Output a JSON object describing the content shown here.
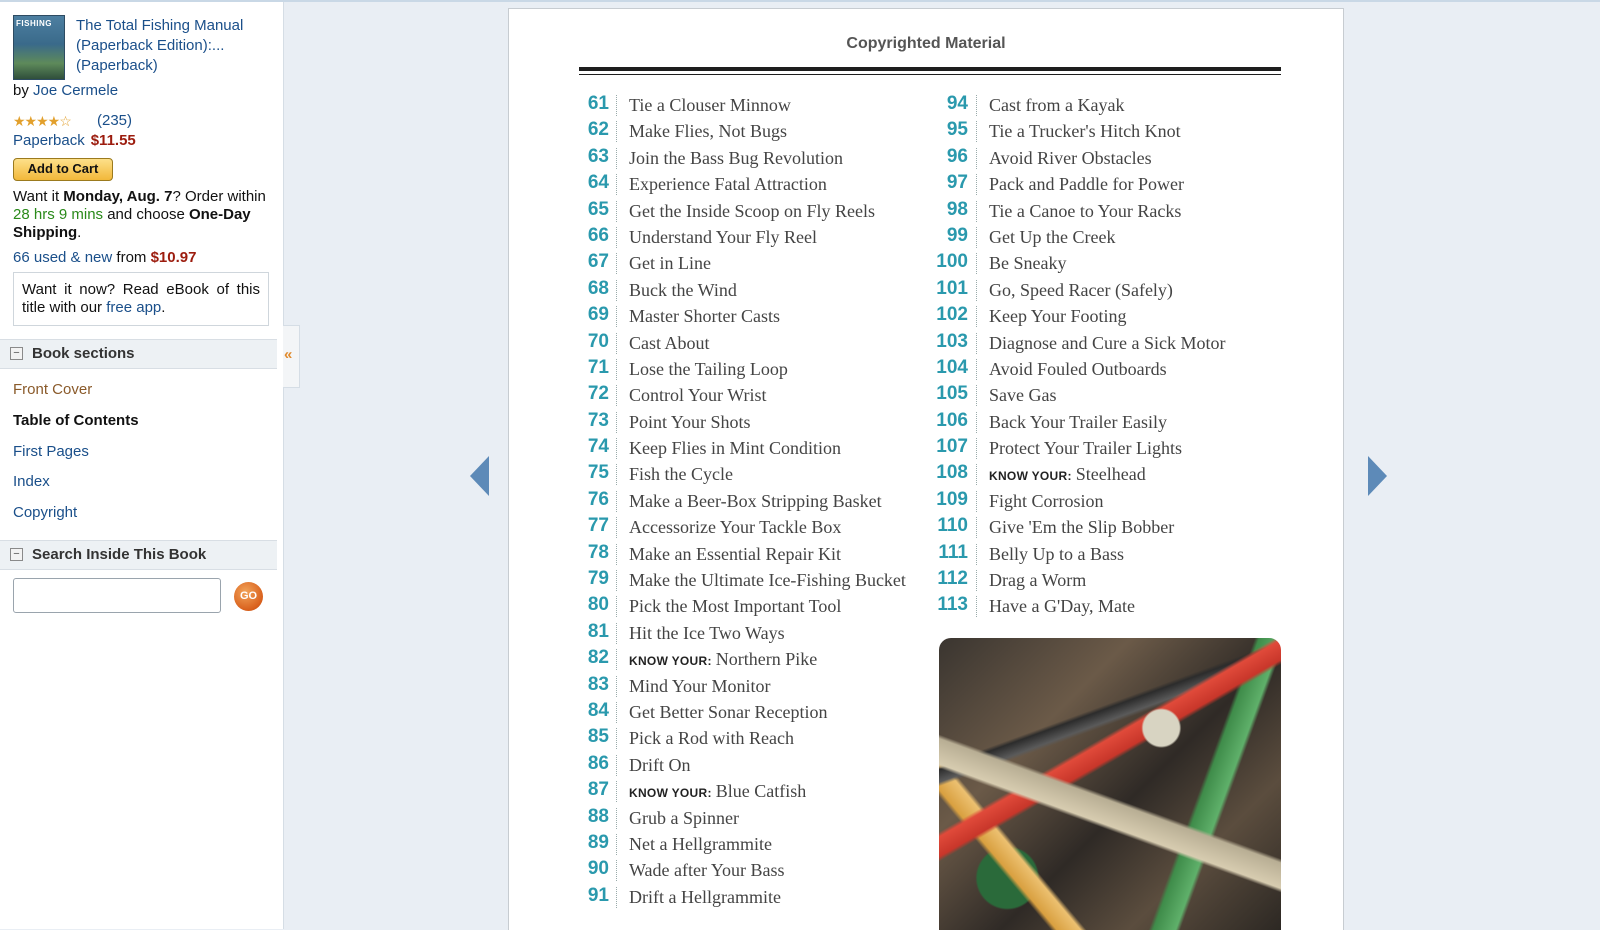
{
  "book": {
    "cover_text": "FISHING",
    "title": "The Total Fishing Manual (Paperback Edition):... (Paperback)",
    "by_label": "by",
    "author": "Joe Cermele",
    "stars": "★★★★☆",
    "review_count": "(235)",
    "format": "Paperback",
    "price": "$11.55",
    "add_to_cart": "Add to Cart"
  },
  "delivery": {
    "want_it": "Want it",
    "date": "Monday, Aug. 7",
    "order_within": "? Order within",
    "countdown": "28 hrs 9 mins",
    "and_choose": "and choose",
    "shipping": "One-Day Shipping",
    "period": "."
  },
  "offers": {
    "used_new": "66 used & new",
    "from": "from",
    "price": "$10.97"
  },
  "ebook": {
    "text": "Want it now? Read eBook of this title with our",
    "link": "free app",
    "period": "."
  },
  "sections": {
    "header": "Book sections",
    "items": [
      {
        "label": "Front Cover",
        "color": "#8a5a2a",
        "bold": false
      },
      {
        "label": "Table of Contents",
        "color": "#111111",
        "bold": true
      },
      {
        "label": "First Pages",
        "color": "#1a4f8a",
        "bold": false
      },
      {
        "label": "Index",
        "color": "#1a4f8a",
        "bold": false
      },
      {
        "label": "Copyright",
        "color": "#1a4f8a",
        "bold": false
      }
    ]
  },
  "search": {
    "header": "Search Inside This Book",
    "placeholder": "",
    "go_label": "GO"
  },
  "collapse_icon": "«",
  "page": {
    "header": "Copyrighted Material",
    "toc_left": [
      {
        "num": "61",
        "title": "Tie a Clouser Minnow"
      },
      {
        "num": "62",
        "title": "Make Flies, Not Bugs"
      },
      {
        "num": "63",
        "title": "Join the Bass Bug Revolution"
      },
      {
        "num": "64",
        "title": "Experience Fatal Attraction"
      },
      {
        "num": "65",
        "title": "Get the Inside Scoop on Fly Reels"
      },
      {
        "num": "66",
        "title": "Understand Your Fly Reel"
      },
      {
        "num": "67",
        "title": "Get in Line"
      },
      {
        "num": "68",
        "title": "Buck the Wind"
      },
      {
        "num": "69",
        "title": "Master Shorter Casts"
      },
      {
        "num": "70",
        "title": "Cast About"
      },
      {
        "num": "71",
        "title": "Lose the Tailing Loop"
      },
      {
        "num": "72",
        "title": "Control Your Wrist"
      },
      {
        "num": "73",
        "title": "Point Your Shots"
      },
      {
        "num": "74",
        "title": "Keep Flies in Mint Condition"
      },
      {
        "num": "75",
        "title": "Fish the Cycle"
      },
      {
        "num": "76",
        "title": "Make a Beer-Box Stripping Basket"
      },
      {
        "num": "77",
        "title": "Accessorize Your Tackle Box"
      },
      {
        "num": "78",
        "title": "Make an Essential Repair Kit"
      },
      {
        "num": "79",
        "title": "Make the Ultimate Ice-Fishing Bucket"
      },
      {
        "num": "80",
        "title": "Pick the Most Important Tool"
      },
      {
        "num": "81",
        "title": "Hit the Ice Two Ways"
      },
      {
        "num": "82",
        "prefix": "KNOW YOUR:",
        "title": "Northern Pike"
      },
      {
        "num": "83",
        "title": "Mind Your Monitor"
      },
      {
        "num": "84",
        "title": "Get Better Sonar Reception"
      },
      {
        "num": "85",
        "title": "Pick a Rod with Reach"
      },
      {
        "num": "86",
        "title": "Drift On"
      },
      {
        "num": "87",
        "prefix": "KNOW YOUR:",
        "title": "Blue Catfish"
      },
      {
        "num": "88",
        "title": "Grub a Spinner"
      },
      {
        "num": "89",
        "title": "Net a Hellgrammite"
      },
      {
        "num": "90",
        "title": "Wade after Your Bass"
      },
      {
        "num": "91",
        "title": "Drift a Hellgrammite"
      }
    ],
    "toc_right": [
      {
        "num": "94",
        "title": "Cast from a Kayak"
      },
      {
        "num": "95",
        "title": "Tie a Trucker's Hitch Knot"
      },
      {
        "num": "96",
        "title": "Avoid River Obstacles"
      },
      {
        "num": "97",
        "title": "Pack and Paddle for Power"
      },
      {
        "num": "98",
        "title": "Tie a Canoe to Your Racks"
      },
      {
        "num": "99",
        "title": "Get Up the Creek"
      },
      {
        "num": "100",
        "title": "Be Sneaky"
      },
      {
        "num": "101",
        "title": "Go, Speed Racer (Safely)"
      },
      {
        "num": "102",
        "title": "Keep Your Footing"
      },
      {
        "num": "103",
        "title": "Diagnose and Cure a Sick Motor"
      },
      {
        "num": "104",
        "title": "Avoid Fouled Outboards"
      },
      {
        "num": "105",
        "title": "Save Gas"
      },
      {
        "num": "106",
        "title": "Back Your Trailer Easily"
      },
      {
        "num": "107",
        "title": "Protect Your Trailer Lights"
      },
      {
        "num": "108",
        "prefix": "KNOW YOUR:",
        "title": "Steelhead"
      },
      {
        "num": "109",
        "title": "Fight Corrosion"
      },
      {
        "num": "110",
        "title": "Give 'Em the Slip Bobber"
      },
      {
        "num": "111",
        "title": "Belly Up to a Bass"
      },
      {
        "num": "112",
        "title": "Drag a Worm"
      },
      {
        "num": "113",
        "title": "Have a G'Day, Mate"
      }
    ]
  },
  "colors": {
    "toc_number": "#2a99ad",
    "link": "#1a4f8a",
    "price": "#9c1c0e",
    "nav_arrow": "#5d8ab8"
  }
}
